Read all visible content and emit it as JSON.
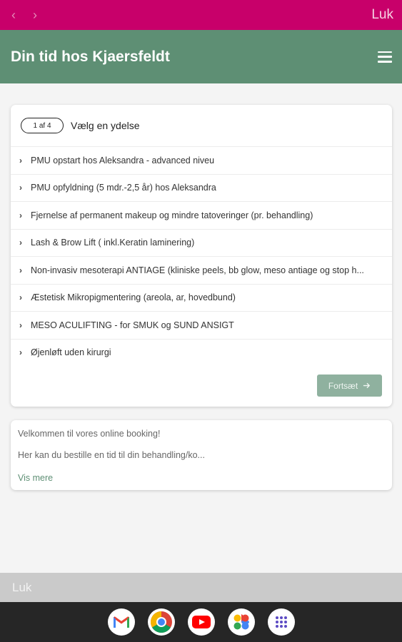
{
  "browser": {
    "back_arrow": "‹",
    "forward_arrow": "›",
    "close_label": "Luk"
  },
  "app": {
    "title": "Din tid hos Kjaersfeldt"
  },
  "booking": {
    "step": "1 af 4",
    "heading": "Vælg en ydelse",
    "services": [
      "PMU opstart hos Aleksandra - advanced niveu",
      "PMU opfyldning (5 mdr.-2,5 år) hos Aleksandra",
      "Fjernelse af permanent makeup og mindre tatoveringer (pr. behandling)",
      "Lash & Brow Lift ( inkl.Keratin laminering)",
      "Non-invasiv mesoterapi ANTIAGE (kliniske peels, bb glow, meso antiage og stop h...",
      "Æstetisk Mikropigmentering (areola, ar, hovedbund)",
      "MESO ACULIFTING - for SMUK og SUND ANSIGT",
      "Øjenløft uden kirurgi"
    ],
    "continue_label": "Fortsæt"
  },
  "welcome": {
    "line1": "Velkommen til vores online booking!",
    "line2": "Her kan du bestille en tid til din behandling/ko...",
    "read_more": "Vis mere"
  },
  "bottom": {
    "close_label": "Luk"
  },
  "dock": {
    "apps": [
      "gmail-icon",
      "chrome-icon",
      "youtube-icon",
      "photos-icon",
      "app-drawer-icon"
    ]
  },
  "colors": {
    "topbar": "#c8006a",
    "header": "#5e8f74",
    "button": "#8fb19f"
  }
}
